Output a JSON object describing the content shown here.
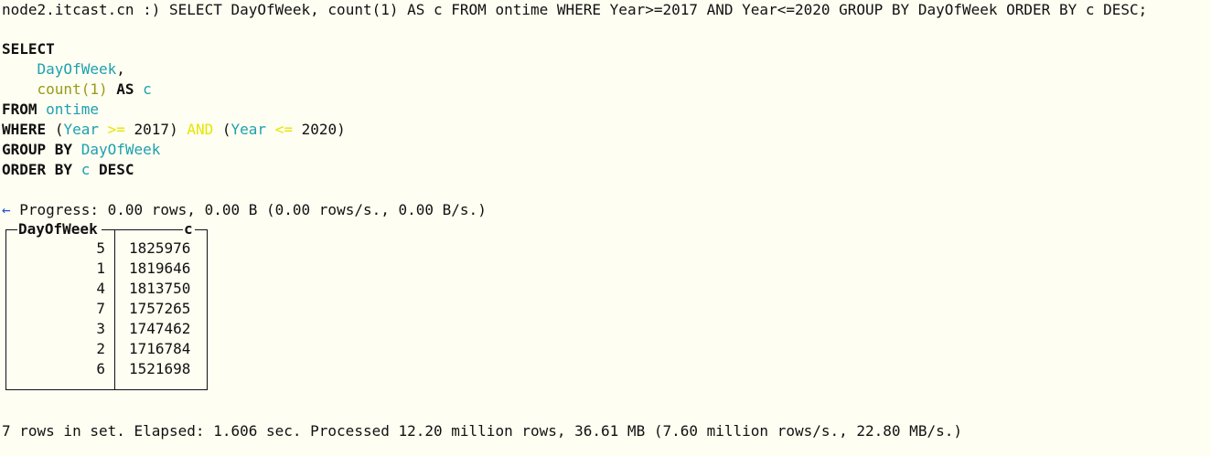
{
  "prompt": {
    "host": "node2.itcast.cn :)",
    "command": "SELECT DayOfWeek, count(1) AS c FROM ontime WHERE Year>=2017 AND Year<=2020 GROUP BY DayOfWeek ORDER BY c DESC;"
  },
  "formatted_query": {
    "select_kw": "SELECT",
    "field1": "DayOfWeek",
    "comma": ",",
    "func": "count(1)",
    "as_kw": "AS",
    "alias": "c",
    "from_kw": "FROM",
    "table": "ontime",
    "where_kw": "WHERE",
    "open1": "(",
    "year1": "Year",
    "op_gte": ">=",
    "val1": "2017)",
    "and_kw": "AND",
    "open2": "(",
    "year2": "Year",
    "op_lte": "<=",
    "val2": "2020)",
    "group_kw": "GROUP BY",
    "group_field": "DayOfWeek",
    "order_kw": "ORDER BY",
    "order_field": "c",
    "desc_kw": "DESC"
  },
  "progress": {
    "arrow": "←",
    "text": "Progress: 0.00 rows, 0.00 B (0.00 rows/s., 0.00 B/s.)"
  },
  "result_table": {
    "headers": [
      "DayOfWeek",
      "c"
    ],
    "rows": [
      [
        "5",
        "1825976"
      ],
      [
        "1",
        "1819646"
      ],
      [
        "4",
        "1813750"
      ],
      [
        "7",
        "1757265"
      ],
      [
        "3",
        "1747462"
      ],
      [
        "2",
        "1716784"
      ],
      [
        "6",
        "1521698"
      ]
    ]
  },
  "summary": "7 rows in set. Elapsed: 1.606 sec. Processed 12.20 million rows, 36.61 MB (7.60 million rows/s., 22.80 MB/s.)",
  "colors": {
    "background": "#fefef2",
    "identifier": "#1ea0b0",
    "function": "#9a9a1a",
    "operator": "#e6e600",
    "arrow": "#2050d0"
  }
}
